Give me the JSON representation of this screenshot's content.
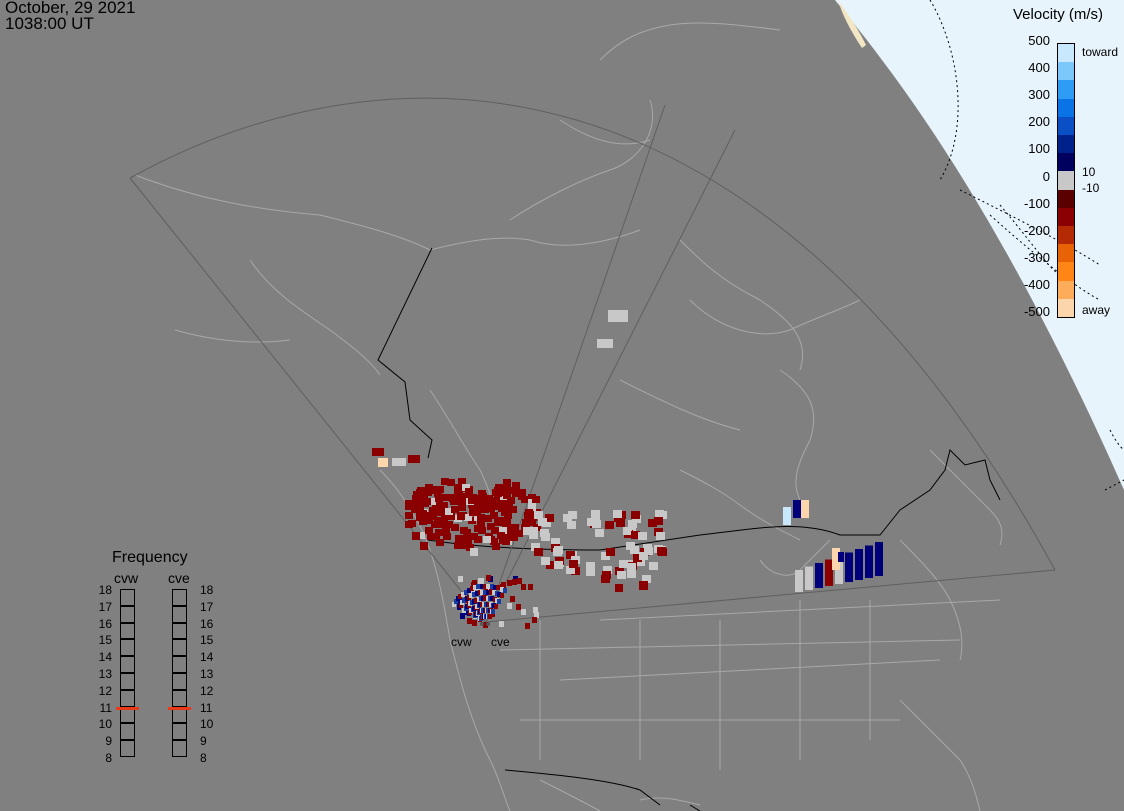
{
  "header": {
    "date": "October, 29 2021",
    "time": "1038:00 UT"
  },
  "colorbar": {
    "title": "Velocity (m/s)",
    "ticks": [
      "500",
      "400",
      "300",
      "200",
      "100",
      "0",
      "-100",
      "-200",
      "-300",
      "-400",
      "-500"
    ],
    "upper_threshold": "10",
    "lower_threshold": "-10",
    "toward_label": "toward",
    "away_label": "away",
    "colors": [
      "#fbd6ad",
      "#fdac5a",
      "#fe8516",
      "#e86306",
      "#b42a04",
      "#8a0000",
      "#5a0000",
      "#c8c8c8",
      "#00005e",
      "#00208a",
      "#0a4fc4",
      "#0a73e6",
      "#2e9cf5",
      "#7cc8fa",
      "#c8e8fd"
    ]
  },
  "frequency": {
    "title": "Frequency",
    "radars": [
      "cvw",
      "cve"
    ],
    "scale": [
      "18",
      "17",
      "16",
      "15",
      "14",
      "13",
      "12",
      "11",
      "10",
      "9",
      "8"
    ],
    "cvw_mhz": 10.9,
    "cve_mhz": 10.9,
    "marker_color": "#e83a1a"
  },
  "sites": [
    {
      "code": "cvw"
    },
    {
      "code": "cve"
    }
  ],
  "map_colors": {
    "background": "#808080",
    "coast": "#a8a8a8",
    "border": "#000000",
    "fov": "#5f5f5f",
    "night_side": "#e8f4fc",
    "ground_scatter": "#c8c8c8"
  }
}
